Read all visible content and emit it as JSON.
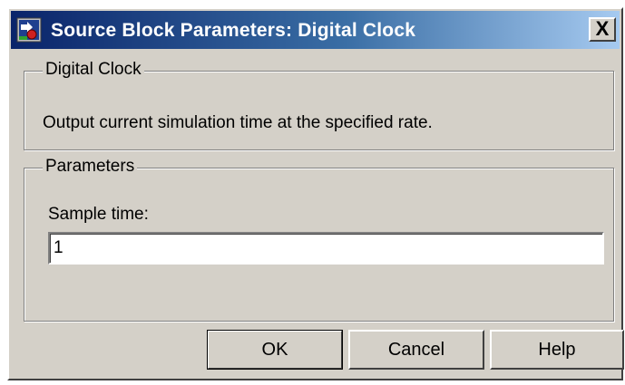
{
  "window": {
    "title": "Source Block Parameters: Digital Clock",
    "close_label": "X",
    "icon": "simulink-block-icon"
  },
  "description_group": {
    "legend": "Digital Clock",
    "text": "Output current simulation time at the specified rate."
  },
  "parameters_group": {
    "legend": "Parameters",
    "sample_time_label": "Sample time:",
    "sample_time_value": "1"
  },
  "buttons": {
    "ok": "OK",
    "cancel": "Cancel",
    "help": "Help"
  }
}
